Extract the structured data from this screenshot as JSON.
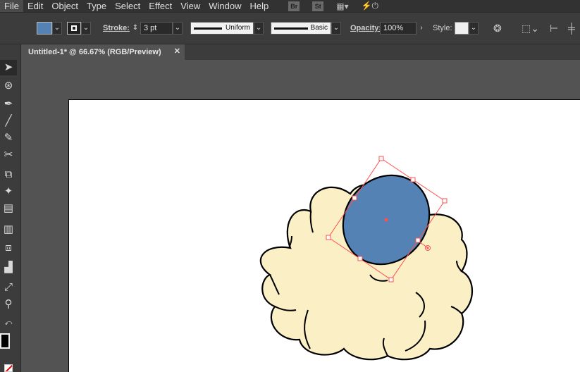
{
  "menu": {
    "items": [
      "File",
      "Edit",
      "Object",
      "Type",
      "Select",
      "Effect",
      "View",
      "Window",
      "Help"
    ],
    "bridge_badge": "Br",
    "stock_badge": "St"
  },
  "control": {
    "stroke_label": "Stroke:",
    "stroke_weight": "3 pt",
    "profile_label": "Uniform",
    "brush_label": "Basic",
    "opacity_label": "Opacity:",
    "opacity_value": "100%",
    "style_label": "Style:",
    "fill_color": "#5582b4"
  },
  "document": {
    "tab_title": "Untitled-1* @ 66.67% (RGB/Preview)",
    "close_glyph": "✕"
  },
  "artwork": {
    "cloud_color": "#fbefc5",
    "ellipse_color": "#5582b4",
    "selection_color": "#ff5050"
  }
}
